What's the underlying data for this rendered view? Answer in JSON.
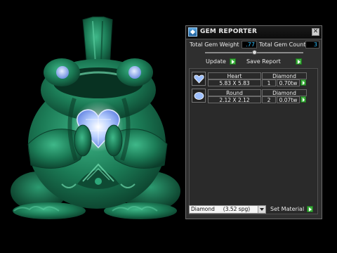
{
  "panel": {
    "title": "GEM REPORTER",
    "close_glyph": "✕",
    "stats": {
      "weight_label": "Total Gem Weight",
      "weight_value": ".77",
      "count_label": "Total Gem Count",
      "count_value": "3"
    },
    "slider_level": 0.5,
    "buttons": {
      "update": "Update",
      "save_report": "Save Report"
    },
    "gems": [
      {
        "icon": "heart-gem-icon",
        "shape": "Heart",
        "size": "5.83 X 5.83",
        "material": "Diamond",
        "count": "1",
        "weight": "0.70tw"
      },
      {
        "icon": "round-gem-icon",
        "shape": "Round",
        "size": "2.12 X 2.12",
        "material": "Diamond",
        "count": "2",
        "weight": "0.07tw"
      }
    ],
    "material_select": {
      "value": "Diamond     (3.52 spg)"
    },
    "set_material": "Set Material"
  },
  "colors": {
    "accent_go": "#3cae3c",
    "value_text": "#2fc0ff",
    "model_green": "#1f8a62",
    "gem_blue": "#8fb8ff"
  }
}
